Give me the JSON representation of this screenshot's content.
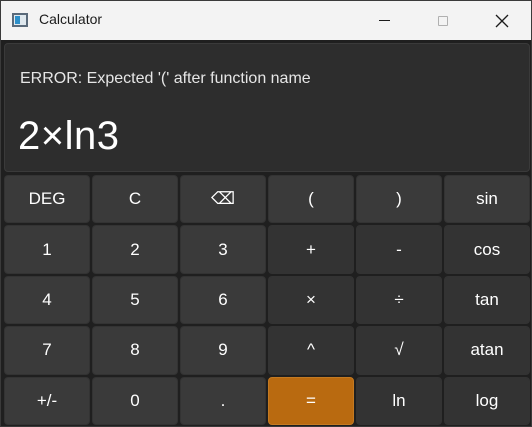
{
  "window": {
    "title": "Calculator",
    "accent_color": "#b96a10"
  },
  "display": {
    "error": "ERROR: Expected '(' after function name",
    "expression": "2×ln3"
  },
  "keypad": {
    "rows": [
      [
        "DEG",
        "C",
        "⌫",
        "(",
        ")",
        "sin"
      ],
      [
        "1",
        "2",
        "3",
        "+",
        "-",
        "cos"
      ],
      [
        "4",
        "5",
        "6",
        "×",
        "÷",
        "tan"
      ],
      [
        "7",
        "8",
        "9",
        "^",
        "√",
        "atan"
      ],
      [
        "+/-",
        "0",
        ".",
        "=",
        "ln",
        "log"
      ]
    ]
  }
}
